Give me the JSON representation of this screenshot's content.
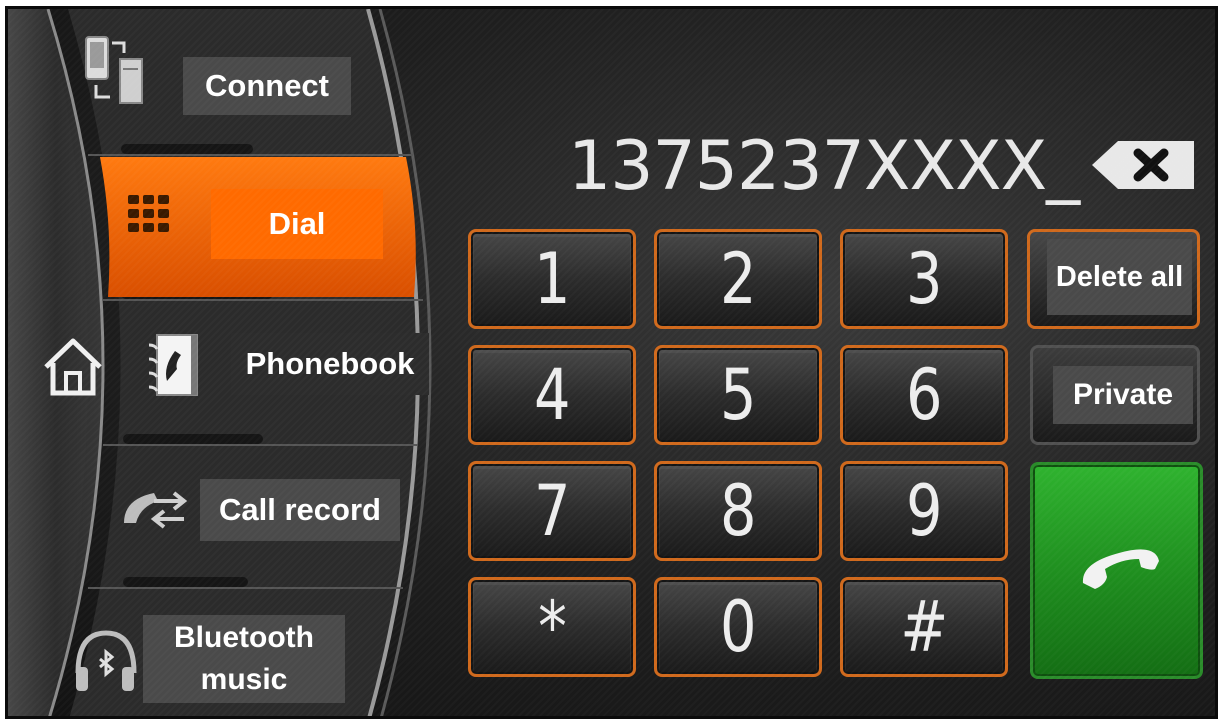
{
  "nav": {
    "items": [
      {
        "id": "connect",
        "label": "Connect",
        "icon": "device-connect-icon",
        "active": false
      },
      {
        "id": "dial",
        "label": "Dial",
        "icon": "keypad-icon",
        "active": true
      },
      {
        "id": "phonebook",
        "label": "Phonebook",
        "icon": "phonebook-icon",
        "active": false
      },
      {
        "id": "call-record",
        "label": "Call record",
        "icon": "call-record-icon",
        "active": false
      },
      {
        "id": "bluetooth-music",
        "label": "Bluetooth music",
        "icon": "bluetooth-headphones-icon",
        "active": false
      }
    ],
    "home_icon": "home-icon"
  },
  "dialer": {
    "number": "1375237XXXX_",
    "backspace_icon": "backspace-icon"
  },
  "keypad": {
    "keys": [
      "1",
      "2",
      "3",
      "4",
      "5",
      "6",
      "7",
      "8",
      "9",
      "*",
      "0",
      "#"
    ]
  },
  "actions": {
    "delete_all": "Delete all",
    "private": "Private",
    "call_icon": "call-handset-icon"
  },
  "colors": {
    "accent": "#ff6a00",
    "key_border": "#d0691c",
    "call_green": "#2fb32f",
    "label_bg": "#4a4a4a"
  }
}
